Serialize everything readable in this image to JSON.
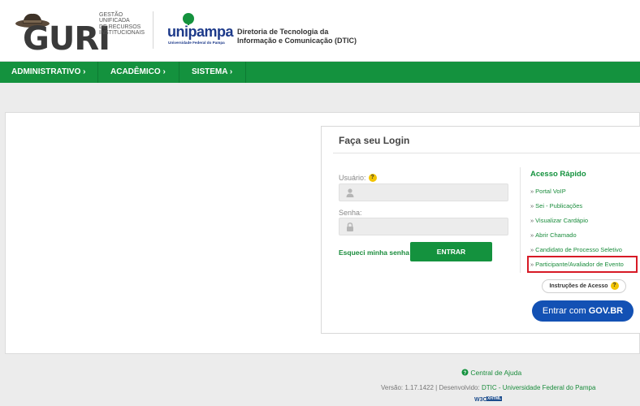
{
  "header": {
    "guri_logo": "GURI",
    "guri_subtitle": [
      "GESTÃO",
      "UNIFICADA",
      "DE RECURSOS",
      "INSTITUCIONAIS"
    ],
    "unipampa_logo": "unipampa",
    "unipampa_subtitle": "Universidade Federal do Pampa",
    "dtic_title_line1": "Diretoria de Tecnologia da",
    "dtic_title_line2": "Informação e Comunicação (DTIC)"
  },
  "nav": {
    "items": [
      {
        "label": "ADMINISTRATIVO ›"
      },
      {
        "label": "ACADÊMICO ›"
      },
      {
        "label": "SISTEMA ›"
      }
    ]
  },
  "login": {
    "title": "Faça seu Login",
    "user_label": "Usuário:",
    "password_label": "Senha:",
    "user_value": "",
    "password_value": "",
    "help_mark": "?",
    "forgot_label": "Esqueci minha senha",
    "submit_label": "ENTRAR"
  },
  "quick_access": {
    "title": "Acesso Rápido",
    "arrow": "»",
    "links": [
      {
        "label": "Portal VoIP"
      },
      {
        "label": "Sei - Publicações"
      },
      {
        "label": "Visualizar Cardápio"
      },
      {
        "label": "Abrir Chamado"
      },
      {
        "label": "Candidato de Processo Seletivo"
      },
      {
        "label": "Participante/Avaliador de Evento"
      }
    ],
    "instructions_label": "Instruções de Acesso",
    "gov_prefix": "Entrar com ",
    "gov_brand": "GOV.BR"
  },
  "footer": {
    "help_center": "Central de Ajuda",
    "version_prefix": "Versão: 1.17.1422 | Desenvolvido: ",
    "version_link": "DTIC - Universidade Federal do Pampa",
    "w3c_label": "W3C",
    "xhtml_label": "XHTML"
  },
  "colors": {
    "brand_green": "#14923e",
    "gov_blue": "#1351b4",
    "highlight_red": "#d71a26",
    "help_yellow": "#f2c400"
  }
}
